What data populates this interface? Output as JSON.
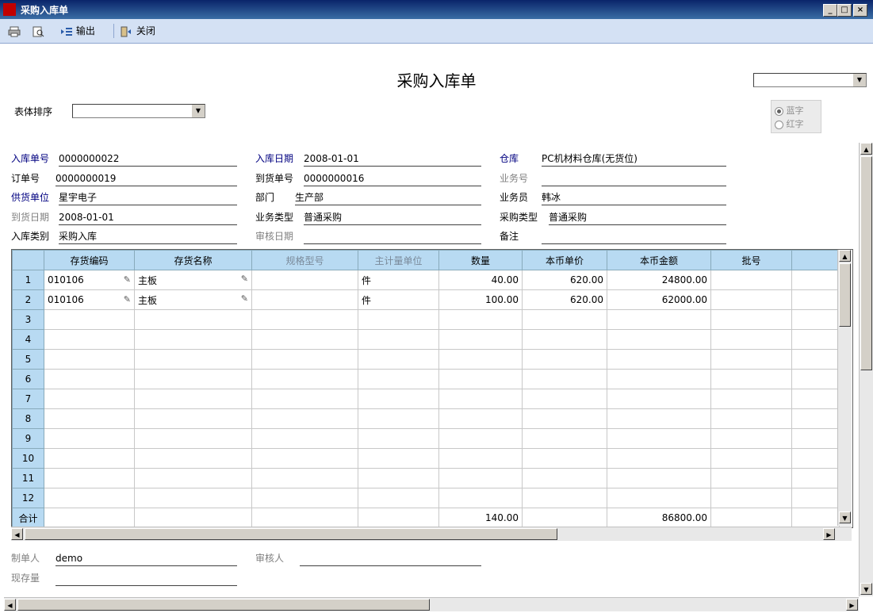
{
  "window": {
    "title": "采购入库单",
    "min_label": "_",
    "max_label": "□",
    "close_label": "×"
  },
  "toolbar": {
    "output_label": "输出",
    "close_label": "关闭"
  },
  "form": {
    "title": "采购入库单",
    "sort_label": "表体排序",
    "radio_blue": "蓝字",
    "radio_red": "红字"
  },
  "header": {
    "receipt_no_label": "入库单号",
    "receipt_no": "0000000022",
    "receipt_date_label": "入库日期",
    "receipt_date": "2008-01-01",
    "warehouse_label": "仓库",
    "warehouse": "PC机材料仓库(无货位)",
    "order_no_label": "订单号",
    "order_no": "0000000019",
    "arrival_no_label": "到货单号",
    "arrival_no": "0000000016",
    "business_no_label": "业务号",
    "business_no": "",
    "supplier_label": "供货单位",
    "supplier": "星宇电子",
    "department_label": "部门",
    "department": "生产部",
    "salesman_label": "业务员",
    "salesman": "韩冰",
    "arrival_date_label": "到货日期",
    "arrival_date": "2008-01-01",
    "business_type_label": "业务类型",
    "business_type": "普通采购",
    "purchase_type_label": "采购类型",
    "purchase_type": "普通采购",
    "receipt_type_label": "入库类别",
    "receipt_type": "采购入库",
    "audit_date_label": "审核日期",
    "audit_date": "",
    "remark_label": "备注",
    "remark": ""
  },
  "grid": {
    "columns": [
      "存货编码",
      "存货名称",
      "规格型号",
      "主计量单位",
      "数量",
      "本币单价",
      "本币金额",
      "批号"
    ],
    "rows": [
      {
        "n": "1",
        "code": "010106",
        "name": "主板",
        "spec": "",
        "unit": "件",
        "qty": "40.00",
        "price": "620.00",
        "amount": "24800.00",
        "batch": ""
      },
      {
        "n": "2",
        "code": "010106",
        "name": "主板",
        "spec": "",
        "unit": "件",
        "qty": "100.00",
        "price": "620.00",
        "amount": "62000.00",
        "batch": ""
      },
      {
        "n": "3"
      },
      {
        "n": "4"
      },
      {
        "n": "5"
      },
      {
        "n": "6"
      },
      {
        "n": "7"
      },
      {
        "n": "8"
      },
      {
        "n": "9"
      },
      {
        "n": "10"
      },
      {
        "n": "11"
      },
      {
        "n": "12"
      }
    ],
    "total_label": "合计",
    "total_qty": "140.00",
    "total_amount": "86800.00"
  },
  "footer": {
    "maker_label": "制单人",
    "maker": "demo",
    "auditor_label": "审核人",
    "auditor": "",
    "stock_label": "现存量",
    "stock": ""
  }
}
